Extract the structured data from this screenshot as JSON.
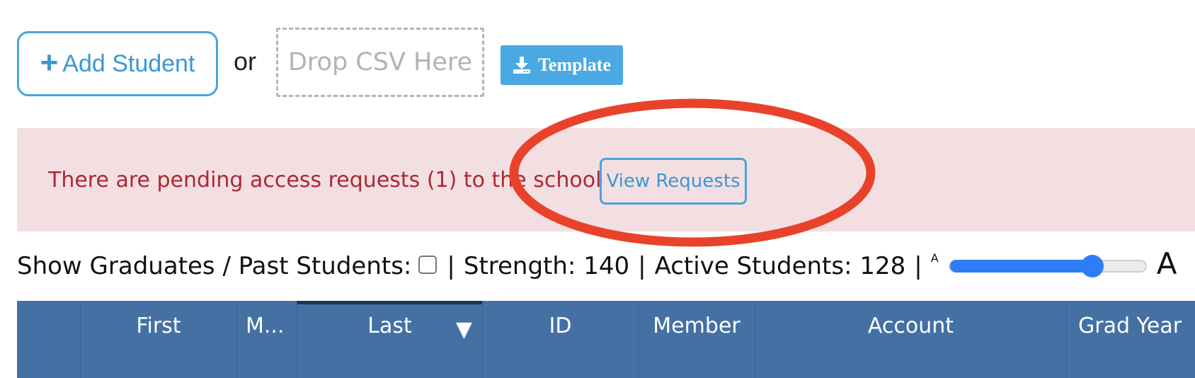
{
  "toolbar": {
    "add_student_label": "Add Student",
    "or_text": "or",
    "drop_zone_label": "Drop CSV Here",
    "template_label": "Template"
  },
  "alert": {
    "message": "There are pending access requests (1) to the school",
    "button_label": "View Requests"
  },
  "stats": {
    "show_graduates_label": "Show Graduates / Past Students:",
    "show_graduates_checked": false,
    "strength_text": "Strength: 140",
    "active_students_text": "Active Students: 128",
    "separator": "|",
    "font_small_label": "A",
    "font_large_label": "A",
    "font_size_slider_fraction": 0.73
  },
  "table": {
    "columns": [
      {
        "key": "select",
        "label": ""
      },
      {
        "key": "first",
        "label": "First"
      },
      {
        "key": "middle",
        "label": "M..."
      },
      {
        "key": "last",
        "label": "Last",
        "sort_indicator": "▼"
      },
      {
        "key": "id",
        "label": "ID"
      },
      {
        "key": "member",
        "label": "Member"
      },
      {
        "key": "account",
        "label": "Account"
      },
      {
        "key": "grad_year",
        "label": "Grad Year"
      }
    ]
  },
  "colors": {
    "accent_blue": "#4aa3dc",
    "alert_background": "#f3dfe1",
    "alert_text": "#a82a36",
    "table_header": "#4470a4",
    "slider_blue": "#2f7df6",
    "annotation_red": "#e8432a"
  }
}
